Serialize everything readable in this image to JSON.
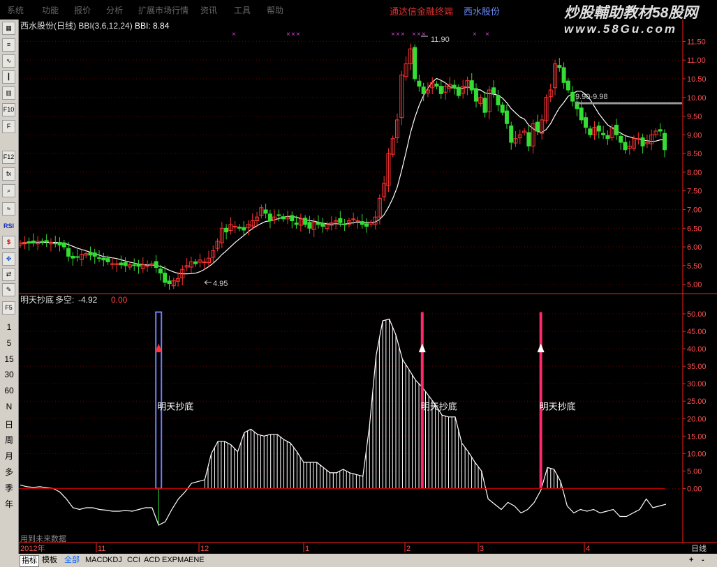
{
  "menu": [
    "系统",
    "功能",
    "报价",
    "分析",
    "扩展市场行情",
    "资讯",
    "工具",
    "帮助"
  ],
  "app_title": "通达信金融终端",
  "stock_title": "西水股份",
  "watermark": {
    "line1": "炒股輔助教材58股网",
    "line2": "www.58Gu.com"
  },
  "toolbar": {
    "buttons": [
      "grid-icon",
      "list-icon",
      "line-chart-icon",
      "candle-icon",
      "kline-icon",
      "F10",
      "F",
      "F12",
      "fx",
      "zoom-icon",
      "wave-icon",
      "RSI",
      "dollar-icon",
      "move-icon",
      "export-icon",
      "pencil-icon",
      "F5"
    ],
    "periods": [
      "1",
      "5",
      "15",
      "30",
      "60",
      "N",
      "日",
      "周",
      "月",
      "多",
      "季",
      "年"
    ]
  },
  "main_panel": {
    "title": "西水股份(日线) BBI(3,6,12,24)",
    "bbi_label": "BBI: 8.84",
    "y_ticks": [
      "11.50",
      "11.00",
      "10.50",
      "10.00",
      "9.50",
      "9.00",
      "8.50",
      "8.00",
      "7.50",
      "7.00",
      "6.50",
      "6.00",
      "5.50",
      "5.00"
    ],
    "annotations": {
      "high": "11.90",
      "low": "4.95",
      "range": "9.90-9.98"
    }
  },
  "sub_panel": {
    "title": "明天抄底",
    "duokong_label": "多空:",
    "duokong_value": "-4.92",
    "extra_value": "0.00",
    "y_ticks": [
      "50.00",
      "45.00",
      "40.00",
      "35.00",
      "30.00",
      "25.00",
      "20.00",
      "15.00",
      "10.00",
      "5.00",
      "0.00"
    ],
    "signal_label": "明天抄底",
    "footer_note": "用到未来数据"
  },
  "x_axis": {
    "labels": [
      "2012年",
      "11",
      "12",
      "1",
      "2",
      "3",
      "4"
    ],
    "period": "日线"
  },
  "bottom_tabs": [
    "指标",
    "模板",
    "全部",
    "MACD",
    "KDJ",
    "CCI",
    "ACD",
    "EXPMA",
    "ENE"
  ],
  "bottom_right": [
    "+",
    "-"
  ],
  "colors": {
    "up": "#ff3333",
    "down": "#33dd33",
    "grid": "#6a0000",
    "axis": "#ff2020",
    "bbi": "#ffffff",
    "signal": "#ff2a6a",
    "blue_bar": "#7080ff",
    "cross": "#cc44cc"
  },
  "chart_data": {
    "type": "candlestick",
    "price_closes": [
      6.1,
      6.12,
      6.1,
      6.12,
      6.15,
      6.13,
      6.14,
      6.12,
      6.1,
      6.05,
      6.0,
      5.75,
      5.7,
      5.72,
      5.8,
      5.82,
      5.78,
      5.75,
      5.7,
      5.65,
      5.6,
      5.55,
      5.55,
      5.52,
      5.5,
      5.52,
      5.5,
      5.48,
      5.52,
      5.5,
      5.55,
      5.45,
      5.3,
      5.05,
      5.02,
      5.1,
      5.15,
      5.4,
      5.5,
      5.6,
      5.55,
      5.65,
      5.6,
      5.7,
      5.9,
      6.15,
      6.5,
      6.4,
      6.6,
      6.55,
      6.5,
      6.45,
      6.6,
      6.7,
      6.8,
      7.05,
      6.9,
      6.7,
      6.8,
      6.85,
      6.75,
      6.8,
      6.7,
      6.6,
      6.75,
      6.6,
      6.5,
      6.65,
      6.6,
      6.55,
      6.6,
      6.65,
      6.7,
      6.65,
      6.6,
      6.7,
      6.75,
      6.7,
      6.6,
      6.55,
      6.65,
      6.8,
      7.3,
      7.7,
      8.5,
      8.9,
      9.4,
      10.6,
      10.9,
      11.3,
      10.5,
      10.3,
      10.1,
      10.2,
      10.4,
      10.3,
      10.1,
      10.3,
      10.35,
      10.25,
      10.05,
      10.3,
      10.45,
      10.2,
      9.9,
      10.0,
      9.6,
      10.2,
      10.1,
      9.8,
      9.6,
      9.3,
      8.8,
      8.9,
      9.0,
      9.1,
      8.7,
      9.3,
      9.1,
      9.4,
      10.0,
      10.2,
      10.9,
      10.8,
      10.4,
      10.2,
      9.9,
      9.7,
      9.4,
      9.2,
      9.0,
      9.2,
      9.1,
      9.0,
      8.9,
      9.2,
      9.0,
      8.8,
      8.6,
      8.7,
      8.9,
      8.9,
      8.7,
      8.8,
      9.0,
      9.1,
      9.1,
      8.6
    ],
    "bbi_label_value": 8.84,
    "indicator": {
      "name": "明天抄底",
      "values": [
        1,
        0.5,
        0.3,
        0.5,
        0.2,
        0,
        -1,
        -3,
        -5.5,
        -6,
        -5.5,
        -5.5,
        -6,
        -6.2,
        -6.5,
        -6.5,
        -6.3,
        -6.5,
        -6,
        -5.5,
        -5.5,
        -10.5,
        -9.5,
        -6,
        -3,
        -1,
        1.5,
        2,
        2.5,
        10,
        13.5,
        13.5,
        12.5,
        10.5,
        16,
        17,
        15.5,
        15,
        15.5,
        15.5,
        14,
        13,
        10.5,
        7.5,
        7.5,
        7.5,
        6,
        4.5,
        4.5,
        5.5,
        4.5,
        4,
        3.5,
        18,
        38,
        48,
        48.5,
        44,
        37,
        34,
        31,
        29,
        26.5,
        24,
        21,
        20.5,
        20.5,
        13,
        10.5,
        7.5,
        5,
        -3,
        -4.5,
        -6,
        -4,
        -5,
        -7,
        -6,
        -4,
        -0.5,
        6,
        5.5,
        2,
        -5,
        -7,
        -6,
        -6.5,
        -6,
        -7,
        -6.5,
        -6,
        -8,
        -8,
        -7,
        -6,
        -3,
        -5.5,
        -5,
        -4.5
      ],
      "ylim": [
        -10,
        50
      ],
      "signals_at": [
        21,
        61,
        79
      ],
      "signal_values": [
        40,
        40,
        40
      ]
    }
  }
}
